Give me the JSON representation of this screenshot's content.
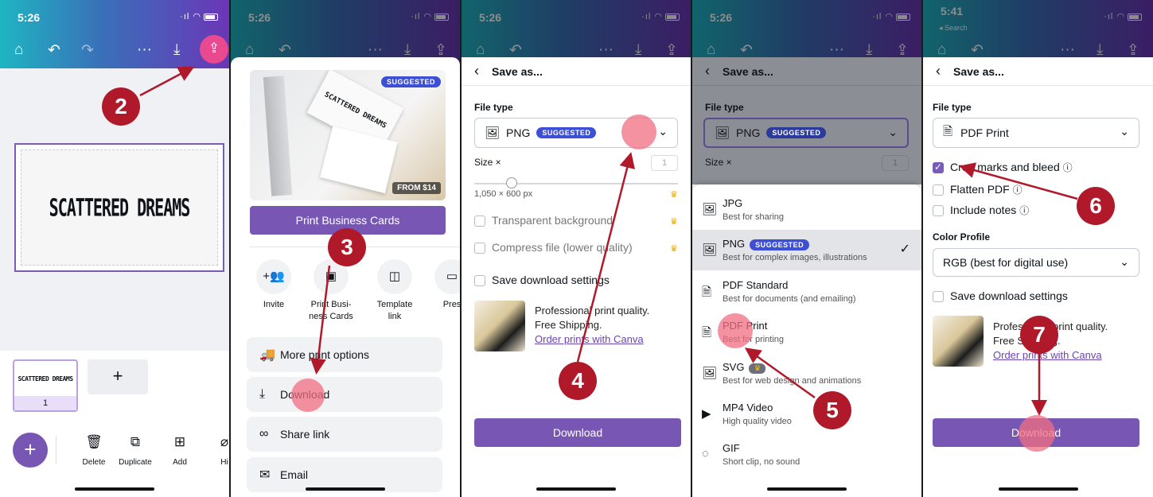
{
  "colors": {
    "brand_purple": "#7857b4",
    "badge_red": "#b0192a",
    "tap": "#f06e82",
    "suggested": "#3d4fd4"
  },
  "steps": [
    "2",
    "3",
    "4",
    "5",
    "6",
    "7"
  ],
  "panel1": {
    "time": "5:26",
    "canvas_text": "SCATTERED DREAMS",
    "thumb_text": "SCATTERED DREAMS",
    "page_number": "1",
    "add_page": "+",
    "fab": "+",
    "toolbar": [
      {
        "icon": "trash-icon",
        "glyph": "🗑",
        "label": "Delete"
      },
      {
        "icon": "duplicate-icon",
        "glyph": "⧉",
        "label": "Duplicate"
      },
      {
        "icon": "add-icon",
        "glyph": "⊞",
        "label": "Add"
      },
      {
        "icon": "hide-icon",
        "glyph": "⌀",
        "label": "Hi"
      }
    ]
  },
  "panel2": {
    "time": "5:26",
    "suggested": "SUGGESTED",
    "card_text": "SCATTERED DREAMS",
    "price": "FROM $14",
    "print_button": "Print Business Cards",
    "share_items": [
      {
        "icon": "invite-icon",
        "glyph": "+👥",
        "label": "Invite"
      },
      {
        "icon": "print-card-icon",
        "glyph": "▣",
        "label": "Print Busi-\nness Cards"
      },
      {
        "icon": "template-icon",
        "glyph": "◫",
        "label": "Template\nlink"
      },
      {
        "icon": "present-icon",
        "glyph": "▭",
        "label": "Pres"
      }
    ],
    "menu": [
      {
        "icon": "truck-icon",
        "glyph": "🚚",
        "label": "More print options"
      },
      {
        "icon": "download-icon",
        "glyph": "⤓",
        "label": "Download"
      },
      {
        "icon": "link-icon",
        "glyph": "∞",
        "label": "Share link"
      },
      {
        "icon": "email-icon",
        "glyph": "✉",
        "label": "Email"
      }
    ]
  },
  "panel3": {
    "time": "5:26",
    "title": "Save as...",
    "file_type_label": "File type",
    "file_type": "PNG",
    "suggested": "SUGGESTED",
    "size_label": "Size ×",
    "size_value": "1",
    "dimensions": "1,050 × 600 px",
    "options": [
      "Transparent background",
      "Compress file (lower quality)"
    ],
    "save_settings": "Save download settings",
    "promo_line1": "Professional print quality.",
    "promo_line2": "Free Shipping.",
    "promo_link": "Order prints with Canva",
    "download": "Download"
  },
  "panel4": {
    "time": "5:26",
    "title": "Save as...",
    "file_type_label": "File type",
    "file_type": "PNG",
    "suggested": "SUGGESTED",
    "size_label": "Size ×",
    "size_value": "1",
    "types": [
      {
        "icon": "image-icon",
        "glyph": "🖼",
        "name": "JPG",
        "desc": "Best for sharing"
      },
      {
        "icon": "image-icon",
        "glyph": "🖼",
        "name": "PNG",
        "badge": "SUGGESTED",
        "desc": "Best for complex images, illustrations",
        "check": "✓"
      },
      {
        "icon": "document-icon",
        "glyph": "🗎",
        "name": "PDF Standard",
        "desc": "Best for documents (and emailing)"
      },
      {
        "icon": "document-icon",
        "glyph": "🗎",
        "name": "PDF Print",
        "desc": "Best for printing"
      },
      {
        "icon": "image-icon",
        "glyph": "🖼",
        "name": "SVG",
        "badge": "♛",
        "desc": "Best for web design and animations"
      },
      {
        "icon": "video-icon",
        "glyph": "▶",
        "name": "MP4 Video",
        "desc": "High quality video"
      },
      {
        "icon": "gif-icon",
        "glyph": "◌",
        "name": "GIF",
        "desc": "Short clip, no sound"
      }
    ]
  },
  "panel5": {
    "time": "5:41",
    "back_app": "◂ Search",
    "title": "Save as...",
    "file_type_label": "File type",
    "file_type": "PDF Print",
    "options": [
      "Crop marks and bleed",
      "Flatten PDF",
      "Include notes"
    ],
    "color_profile_label": "Color Profile",
    "color_profile": "RGB (best for digital use)",
    "save_settings": "Save download settings",
    "promo_line1": "Professional print quality.",
    "promo_line2": "Free Shipping.",
    "promo_link": "Order prints with Canva",
    "download": "Download"
  }
}
